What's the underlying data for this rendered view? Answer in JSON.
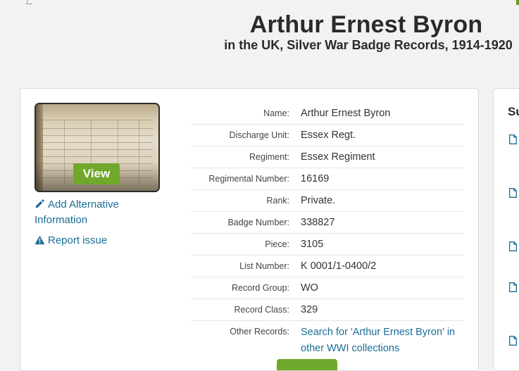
{
  "header": {
    "title": "Arthur Ernest Byron",
    "subtitle": "in the UK, Silver War Badge Records, 1914-1920"
  },
  "image_viewer": {
    "view_label": "View"
  },
  "actions": {
    "add_alt_info": "Add Alternative Information",
    "report_issue": "Report issue"
  },
  "record": {
    "fields": [
      {
        "label": "Name:",
        "value": "Arthur Ernest Byron"
      },
      {
        "label": "Discharge Unit:",
        "value": "Essex Regt."
      },
      {
        "label": "Regiment:",
        "value": "Essex Regiment"
      },
      {
        "label": "Regimental Number:",
        "value": "16169"
      },
      {
        "label": "Rank:",
        "value": "Private."
      },
      {
        "label": "Badge Number:",
        "value": "338827"
      },
      {
        "label": "Piece:",
        "value": "3105"
      },
      {
        "label": "List Number:",
        "value": "K 0001/1-0400/2"
      },
      {
        "label": "Record Group:",
        "value": "WO"
      },
      {
        "label": "Record Class:",
        "value": "329"
      }
    ],
    "other_records": {
      "label": "Other Records:",
      "link": "Search for 'Arthur Ernest Byron' in other WWI collections"
    }
  },
  "sidebar": {
    "heading": "Su"
  },
  "colors": {
    "accent_green": "#6fa82b",
    "link_blue": "#1a6d97",
    "background": "#f2f2f2"
  },
  "icons": [
    "pencil-icon",
    "warning-icon",
    "document-icon"
  ]
}
